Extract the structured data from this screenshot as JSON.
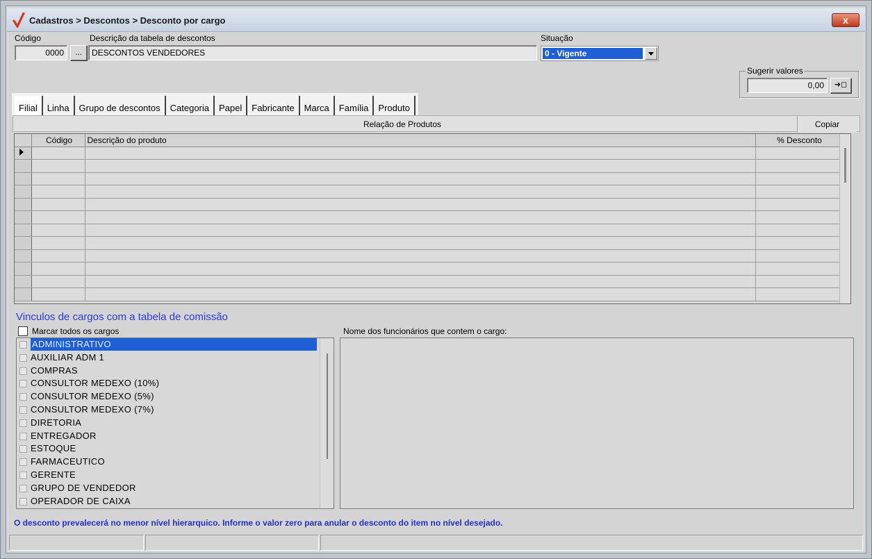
{
  "window": {
    "title": "Cadastros > Descontos > Desconto por cargo",
    "close_label": "x"
  },
  "form": {
    "codigo_label": "Código",
    "codigo_value": "0000",
    "lookup_label": "...",
    "descricao_label": "Descrição da tabela de descontos",
    "descricao_value": "DESCONTOS VENDEDORES",
    "situacao_label": "Situação",
    "situacao_value": "0 - Vigente",
    "sugerir_label": "Sugerir valores",
    "sugerir_value": "0,00",
    "sugerir_btn": "➜◻"
  },
  "tabs": [
    "Filial",
    "Linha",
    "Grupo de descontos",
    "Categoria",
    "Papel",
    "Fabricante",
    "Marca",
    "Família",
    "Produto"
  ],
  "grid": {
    "title": "Relação de Produtos",
    "copy_label": "Copiar",
    "columns": [
      "Código",
      "Descrição do produto",
      "% Desconto"
    ],
    "row_count": 12
  },
  "cargos": {
    "section_title": "Vinculos de cargos com a tabela de comissão",
    "mark_all_label": "Marcar todos os cargos",
    "items": [
      "ADMINISTRATIVO",
      "AUXILIAR ADM 1",
      "COMPRAS",
      "CONSULTOR MEDEXO (10%)",
      "CONSULTOR MEDEXO (5%)",
      "CONSULTOR MEDEXO (7%)",
      "DIRETORIA",
      "ENTREGADOR",
      "ESTOQUE",
      "FARMACEUTICO",
      "GERENTE",
      "GRUPO DE VENDEDOR",
      "OPERADOR DE CAIXA"
    ],
    "selected_index": 0
  },
  "funcionarios": {
    "label": "Nome dos funcionários que contem o cargo:"
  },
  "hint": "O desconto prevalecerá no menor nível hierarquico. Informe o valor zero para anular o desconto do item no nível desejado."
}
